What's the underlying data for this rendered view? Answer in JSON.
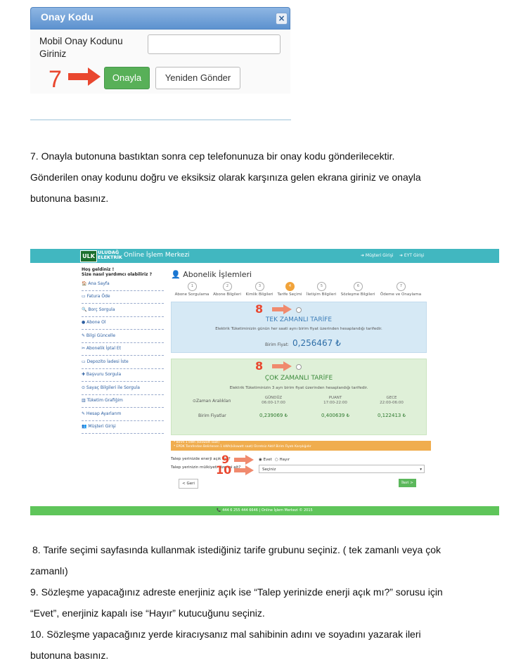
{
  "modal": {
    "title": "Onay Kodu",
    "close": "×",
    "label_line1": "Mobil Onay Kodunu",
    "label_line2": "Giriniz",
    "ok_button": "Onayla",
    "resend_button": "Yeniden Gönder",
    "step_number": "7"
  },
  "paragraph1": {
    "line1": "7. Onayla butonuna bastıktan sonra cep telefonunuza bir onay kodu gönderilecektir.",
    "line2": "Gönderilen onay kodunu doğru ve eksiksiz olarak karşınıza gelen ekrana giriniz ve onayla",
    "line3": "butonuna basınız."
  },
  "portal": {
    "logo_box": "ULK",
    "logo_line1": "ULUDAĞ",
    "logo_line2": "ELEKTRİK",
    "brand": "Online İşlem Merkezi",
    "customer_login": "➜ Müşteri Girişi",
    "eyt_login": "➜ EYT Girişi",
    "greeting_line1": "Hoş geldiniz !",
    "greeting_line2": "Size nasıl yardımcı olabiliriz ?",
    "sidebar": [
      "🏠 Ana Sayfa",
      "▭ Fatura Öde",
      "🔍 Borç Sorgula",
      "● Abone Ol",
      "✎ Bilgi Güncelle",
      "✂ Abonelik İptal Et",
      "▭ Depozito İadesi İste",
      "✚ Başvuru Sorgula",
      "⊙ Sayaç Bilgileri ile Sorgula",
      "▥ Tüketim Grafiğim",
      "✎ Hesap Ayarlarım",
      "👥 Müşteri Girişi"
    ],
    "page_title": "Abonelik İşlemleri",
    "steps": [
      {
        "num": "1",
        "label": "Abone Sorgulama"
      },
      {
        "num": "2",
        "label": "Abone Bilgileri"
      },
      {
        "num": "3",
        "label": "Kimlik Bilgileri"
      },
      {
        "num": "4",
        "label": "Tarife Seçimi"
      },
      {
        "num": "5",
        "label": "İletişim Bilgileri"
      },
      {
        "num": "6",
        "label": "Sözleşme Bilgileri"
      },
      {
        "num": "7",
        "label": "Ödeme ve Onaylama"
      }
    ],
    "single": {
      "step_marker": "8",
      "title": "TEK ZAMANLI TARİFE",
      "desc": "Elektrik Tüketiminizin günün her saati aynı birim fiyat üzerinden hesaplandığı tarifedir.",
      "price_label": "Birim Fiyat:",
      "price": "0,256467 ₺"
    },
    "multi": {
      "step_marker": "8",
      "title": "ÇOK ZAMANLI TARİFE",
      "desc": "Elektrik Tüketiminizin 3 ayrı birim fiyat üzerinden hesaplandığı tarifedir.",
      "row1_label": "⊙Zaman Aralıkları",
      "row2_label": "Birim Fiyatlar",
      "columns": [
        {
          "name": "GÜNDÜZ",
          "time": "06:00-17:00",
          "price": "0,239069 ₺"
        },
        {
          "name": "PUANT",
          "time": "17:00-22:00",
          "price": "0,400639 ₺"
        },
        {
          "name": "GECE",
          "time": "22:00-06:00",
          "price": "0,122413 ₺"
        }
      ]
    },
    "warning_line1": "* Birim 1 kWh (kilowatt saat)",
    "warning_line2": "* EPDK Tarafından Belirlenen 1 kWh(kilowatt saat) Ücretsiz Aktif Birim Fiyatı Karşılığıdır",
    "question1": "Talep yerinizde enerji açık mı ?",
    "question1_marker": "9",
    "option_yes": "◉ Evet",
    "option_no": "○ Hayır",
    "question2": "Talep yerinizin mülkiyeti size mi ait?",
    "question2_marker": "10",
    "select_value": "Seçiniz",
    "back_button": "< Geri",
    "next_button": "İleri >",
    "footer": "📞 444 6 255 444 6646 | Online İşlem Merkezi © 2015"
  },
  "paragraph2": {
    "line1": "8. Tarife seçimi sayfasında kullanmak istediğiniz tarife grubunu seçiniz. ( tek zamanlı veya çok",
    "line2": "zamanlı)",
    "line3": "9. Sözleşme yapacağınız adreste enerjiniz açık ise “Talep yerinizde enerji açık mı?” sorusu için",
    "line4": "“Evet”, enerjiniz kapalı ise “Hayır” kutucuğunu seçiniz.",
    "line5": "10. Sözleşme yapacağınız yerde kiracıysanız mal sahibinin adını ve soyadını yazarak ileri",
    "line6": "butonuna basınız."
  },
  "colors": {
    "arrow": "#e9472f",
    "topbar": "#41b7c0",
    "footer": "#5fc55a",
    "ok_button": "#58b058"
  }
}
